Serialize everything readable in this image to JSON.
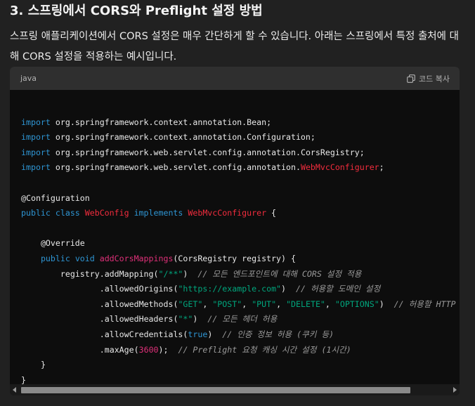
{
  "heading": "3. 스프링에서 CORS와 Preflight 설정 방법",
  "paragraph": "스프링 애플리케이션에서 CORS 설정은 매우 간단하게 할 수 있습니다. 아래는 스프링에서 특정 출처에 대해 CORS 설정을 적용하는 예시입니다.",
  "code_block": {
    "language": "java",
    "copy_label": "코드 복사",
    "lines": [
      "",
      "import org.springframework.context.annotation.Bean;",
      "import org.springframework.context.annotation.Configuration;",
      "import org.springframework.web.servlet.config.annotation.CorsRegistry;",
      "import org.springframework.web.servlet.config.annotation.WebMvcConfigurer;",
      "",
      "@Configuration",
      "public class WebConfig implements WebMvcConfigurer {",
      "",
      "    @Override",
      "    public void addCorsMappings(CorsRegistry registry) {",
      "        registry.addMapping(\"/**\")  // 모든 엔드포인트에 대해 CORS 설정 적용",
      "                .allowedOrigins(\"https://example.com\")  // 허용할 도메인 설정",
      "                .allowedMethods(\"GET\", \"POST\", \"PUT\", \"DELETE\", \"OPTIONS\")  // 허용할 HTTP",
      "                .allowedHeaders(\"*\")  // 모든 헤더 허용",
      "                .allowCredentials(true)  // 인증 정보 허용 (쿠키 등)",
      "                .maxAge(3600);  // Preflight 요청 캐싱 시간 설정 (1시간)",
      "    }",
      "}"
    ]
  },
  "icons": {
    "copy": "copy-icon"
  },
  "colors": {
    "background": "#212121",
    "code_background": "#0d0d0d",
    "code_header": "#2f2f2f",
    "keyword": "#2e95d3",
    "type": "#f22c3d",
    "function": "#df3079",
    "string": "#00a67d",
    "comment": "#9a9a9a"
  }
}
